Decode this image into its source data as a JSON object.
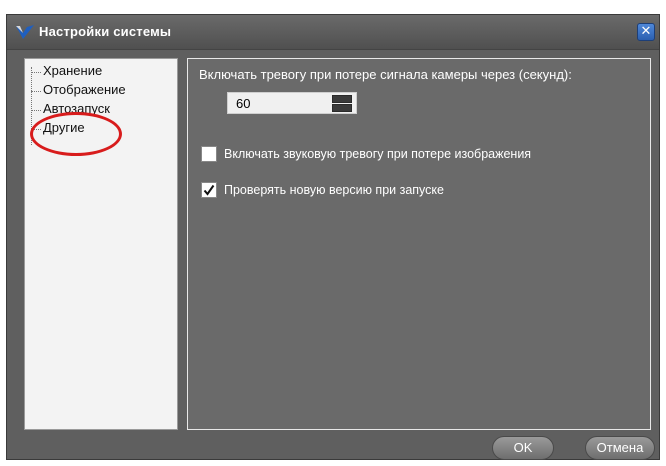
{
  "window": {
    "title": "Настройки системы",
    "close_glyph": "✕"
  },
  "sidebar": {
    "items": [
      {
        "label": "Хранение"
      },
      {
        "label": "Отображение"
      },
      {
        "label": "Автозапуск"
      },
      {
        "label": "Другие",
        "selected": true
      }
    ],
    "highlight_color": "#d81c1c"
  },
  "panel": {
    "timeout_label": "Включать тревогу при потере сигнала камеры через (секунд):",
    "timeout_value": "60",
    "sound_alarm": {
      "label": "Включать звуковую тревогу при потере изображения",
      "checked": false
    },
    "check_version": {
      "label": "Проверять новую версию при запуске",
      "checked": true
    }
  },
  "buttons": {
    "ok": "OK",
    "cancel": "Отмена"
  },
  "icons": {
    "app": "app-logo-icon",
    "close": "close-icon",
    "check": "checkmark-icon"
  }
}
